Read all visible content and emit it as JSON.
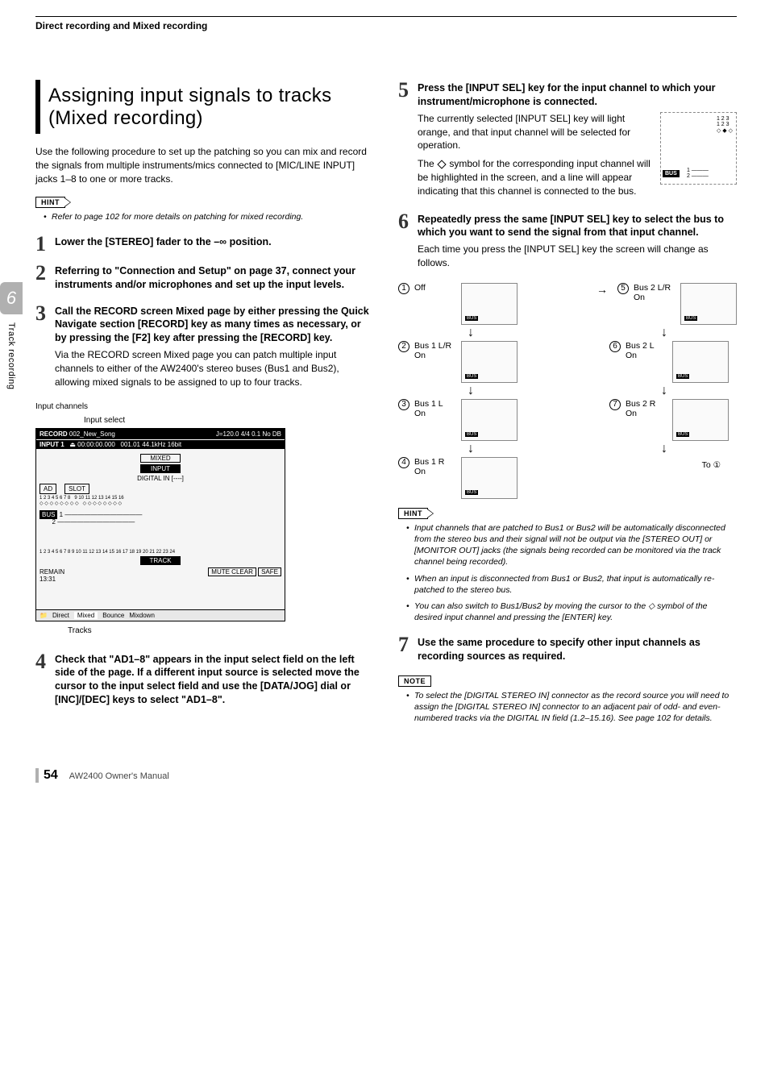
{
  "running_head": "Direct recording and Mixed recording",
  "side_tab": {
    "chapter": "6",
    "title": "Track recording"
  },
  "section_title": "Assigning input signals to tracks (Mixed recording)",
  "intro": "Use the following procedure to set up the patching so you can mix and record the signals from multiple instruments/mics connected to [MIC/LINE INPUT] jacks 1–8 to one or more tracks.",
  "hint_top": [
    "Refer to page 102 for more details on patching for mixed recording."
  ],
  "steps": {
    "s1": {
      "num": "1",
      "head": "Lower the [STEREO] fader to the –∞ position."
    },
    "s2": {
      "num": "2",
      "head": "Referring to \"Connection and Setup\" on page 37, connect your instruments and/or microphones and set up the input levels."
    },
    "s3": {
      "num": "3",
      "head": "Call the RECORD screen Mixed page by either pressing the Quick Navigate section [RECORD] key as many times as necessary, or by pressing the [F2] key after pressing the [RECORD] key.",
      "para": "Via the RECORD screen Mixed page you can patch multiple input channels to either of the AW2400's stereo buses (Bus1 and Bus2), allowing mixed signals to be assigned to up to four tracks."
    },
    "s4": {
      "num": "4",
      "head": "Check that \"AD1–8\" appears in the input select field on the left side of the page. If a different input source is selected move the cursor to the input select field and use the [DATA/JOG] dial or [INC]/[DEC] keys to select \"AD1–8\"."
    },
    "s5": {
      "num": "5",
      "head": "Press the [INPUT SEL] key for the input channel to which your instrument/microphone is connected.",
      "para1": "The currently selected [INPUT SEL] key will light orange, and that input channel will be selected for operation.",
      "para2_a": "The ",
      "para2_b": " symbol for the corresponding input channel will be highlighted in the screen, and a line will appear indicating that this channel is connected to the bus."
    },
    "s6": {
      "num": "6",
      "head": "Repeatedly press the same [INPUT SEL] key to select the bus to which you want to send the signal from that input channel.",
      "para": "Each time you press the [INPUT SEL] key the screen will change as follows."
    },
    "s7": {
      "num": "7",
      "head": "Use the same procedure to specify other input channels as recording sources as required."
    }
  },
  "fig_labels": {
    "input_channels": "Input channels",
    "input_select": "Input select",
    "tracks": "Tracks"
  },
  "screenshot": {
    "title_left": "RECORD",
    "title_sub": "INPUT 1",
    "song": "002_New_Song",
    "tc": "00:00:00.000",
    "tempo": "J=120.0  4/4",
    "scene": "0.1   No DB",
    "rate": "001.01 44.1kHz 16bit",
    "mixed": "MIXED",
    "input": "INPUT",
    "digital_in": "DIGITAL IN",
    "ad": "AD",
    "slot": "SLOT",
    "track": "TRACK",
    "remain": "REMAIN",
    "remain_val": "13:31",
    "mute_clear": "MUTE CLEAR",
    "safe": "SAFE",
    "tab1": "Direct",
    "tab2": "Mixed",
    "tab3": "Bounce",
    "tab4": "Mixdown",
    "bus": "BUS"
  },
  "bus_small": {
    "label": "BUS"
  },
  "bus_states": {
    "b1": "Off",
    "b2": "Bus 1 L/R On",
    "b3": "Bus 1 L On",
    "b4": "Bus 1 R On",
    "b5": "Bus 2 L/R On",
    "b6": "Bus 2 L On",
    "b7": "Bus 2 R On",
    "to": "To ①",
    "chip": "BUS"
  },
  "hint_bottom": [
    "Input channels that are patched to Bus1 or Bus2 will be automatically disconnected from the stereo bus and their signal will not be output via the [STEREO OUT] or [MONITOR OUT] jacks (the signals being recorded can be monitored via the track channel being recorded).",
    "When an input is disconnected from Bus1 or Bus2, that input is automatically re-patched to the stereo bus.",
    "You can also switch to Bus1/Bus2 by moving the cursor to the ◇ symbol of the desired input channel and pressing the [ENTER] key."
  ],
  "note_bottom": [
    "To select the [DIGITAL STEREO IN] connector as the record source you will need to assign the [DIGITAL STEREO IN] connector to an adjacent pair of odd- and even-numbered tracks via the DIGITAL IN field (1.2–15.16). See page 102 for details."
  ],
  "labels": {
    "hint": "HINT",
    "note": "NOTE"
  },
  "footer": {
    "page": "54",
    "manual": "AW2400 Owner's Manual"
  }
}
